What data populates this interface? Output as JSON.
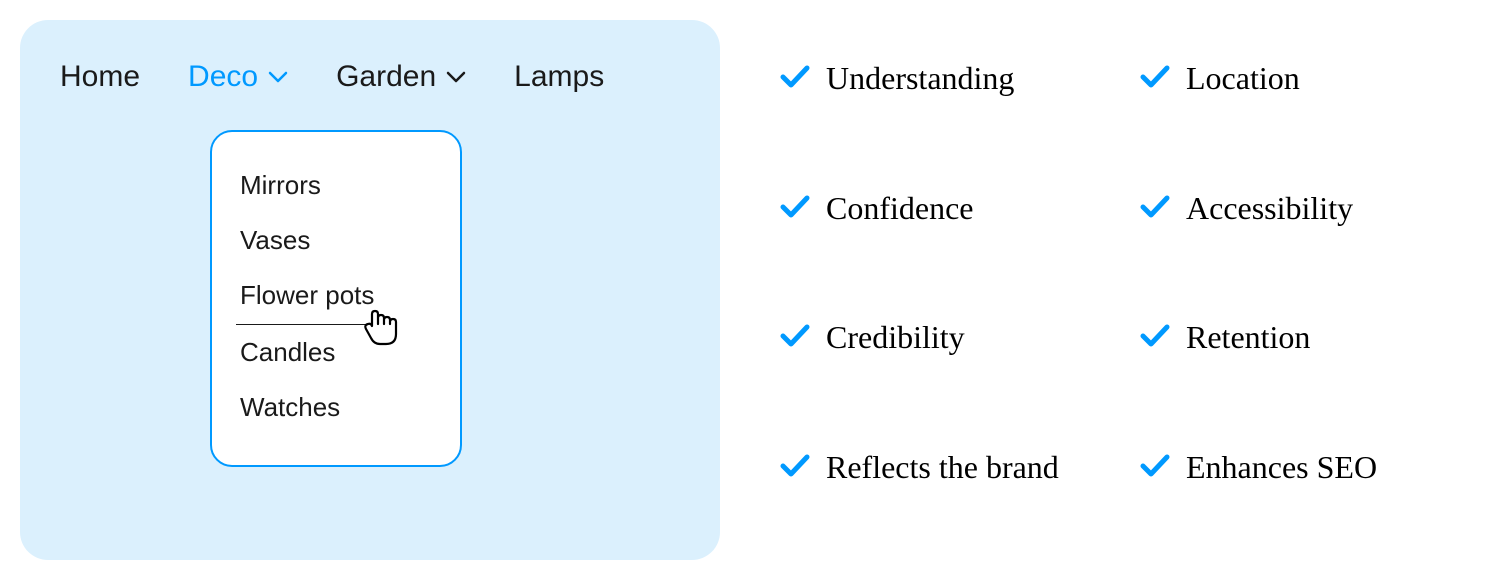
{
  "nav": {
    "items": [
      {
        "label": "Home",
        "has_dropdown": false,
        "active": false
      },
      {
        "label": "Deco",
        "has_dropdown": true,
        "active": true
      },
      {
        "label": "Garden",
        "has_dropdown": true,
        "active": false
      },
      {
        "label": "Lamps",
        "has_dropdown": false,
        "active": false
      }
    ]
  },
  "dropdown": {
    "items": [
      {
        "label": "Mirrors",
        "hover": false
      },
      {
        "label": "Vases",
        "hover": false
      },
      {
        "label": "Flower pots",
        "hover": true
      },
      {
        "label": "Candles",
        "hover": false
      },
      {
        "label": "Watches",
        "hover": false
      }
    ]
  },
  "benefits": {
    "col1": [
      "Understanding",
      "Confidence",
      "Credibility",
      "Reflects the brand"
    ],
    "col2": [
      "Location",
      "Accessibility",
      "Retention",
      "Enhances SEO"
    ]
  },
  "colors": {
    "accent": "#0099ff",
    "panel_bg": "#dbf0fd"
  }
}
